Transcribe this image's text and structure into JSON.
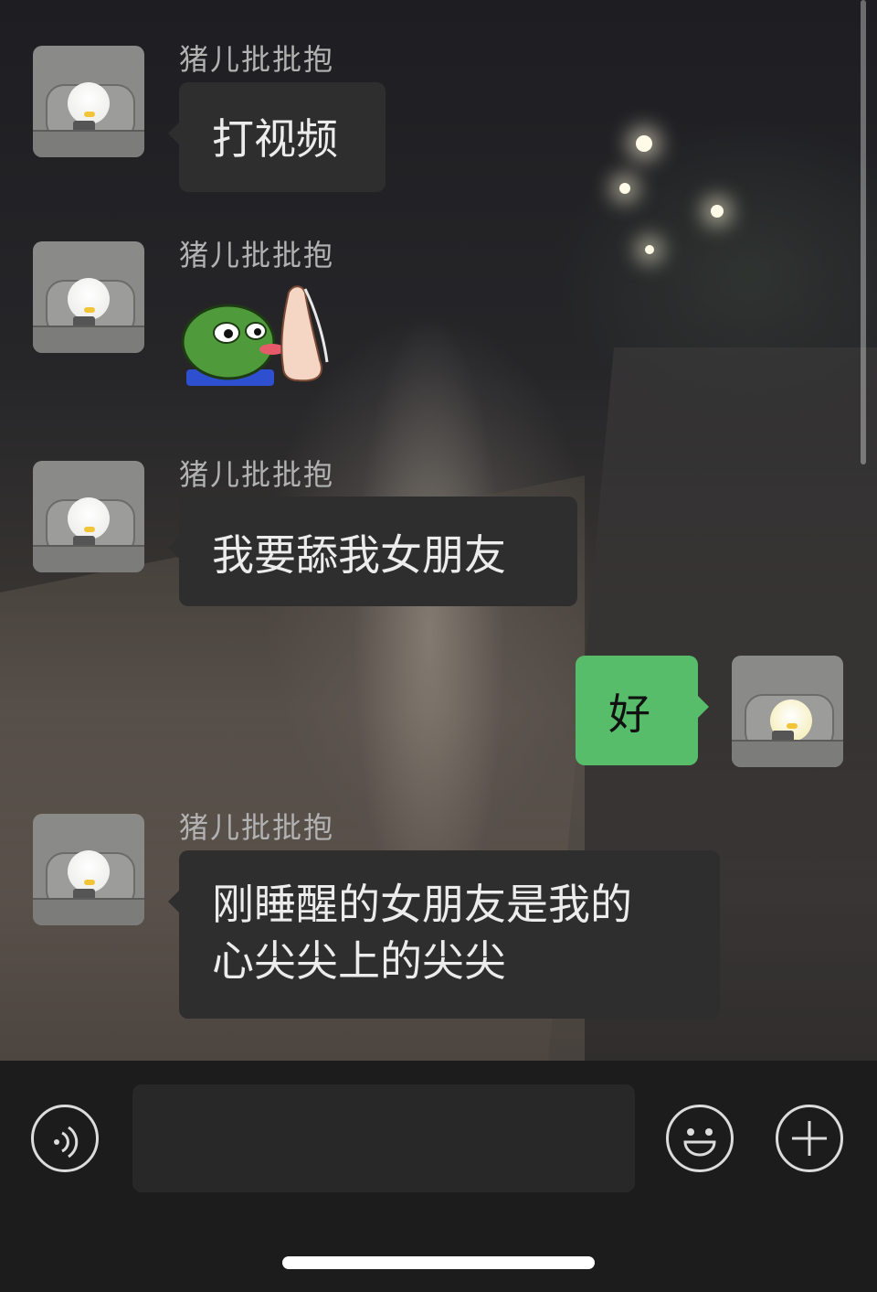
{
  "messages": [
    {
      "sender": "猪儿批批抱",
      "text": "打视频"
    },
    {
      "sender": "猪儿批批抱",
      "sticker": "frog-kissing-foot-sticker"
    },
    {
      "sender": "猪儿批批抱",
      "text": "我要舔我女朋友"
    },
    {
      "sender": "me",
      "text": "好"
    },
    {
      "sender": "猪儿批批抱",
      "text_lines": [
        "刚睡醒的女朋友是我的",
        "心尖尖上的尖尖"
      ]
    }
  ],
  "input_bar": {
    "voice_icon": "voice-icon",
    "emoji_icon": "emoji-icon",
    "plus_icon": "plus-icon",
    "text_value": ""
  },
  "colors": {
    "sent_bubble": "#57bd6a",
    "received_bubble": "#2e2e2e",
    "bottom_bar": "#1c1c1c"
  }
}
